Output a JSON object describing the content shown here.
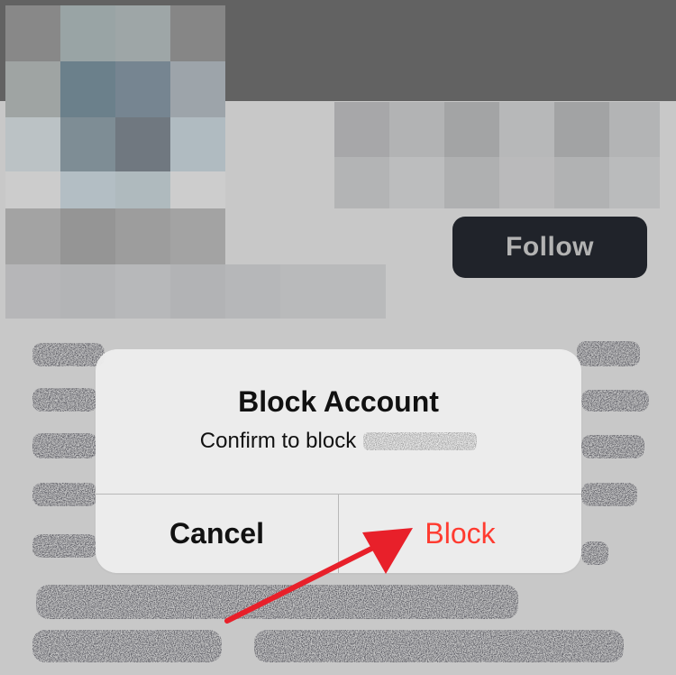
{
  "profile": {
    "follow_label": "Follow"
  },
  "dialog": {
    "title": "Block Account",
    "message": "Confirm to block",
    "cancel_label": "Cancel",
    "block_label": "Block"
  },
  "colors": {
    "destructive": "#ff3b30",
    "follow_button_bg": "#22252c",
    "annotation_arrow": "#e8202a"
  },
  "icons": {
    "annotation": "red-arrow-icon"
  }
}
